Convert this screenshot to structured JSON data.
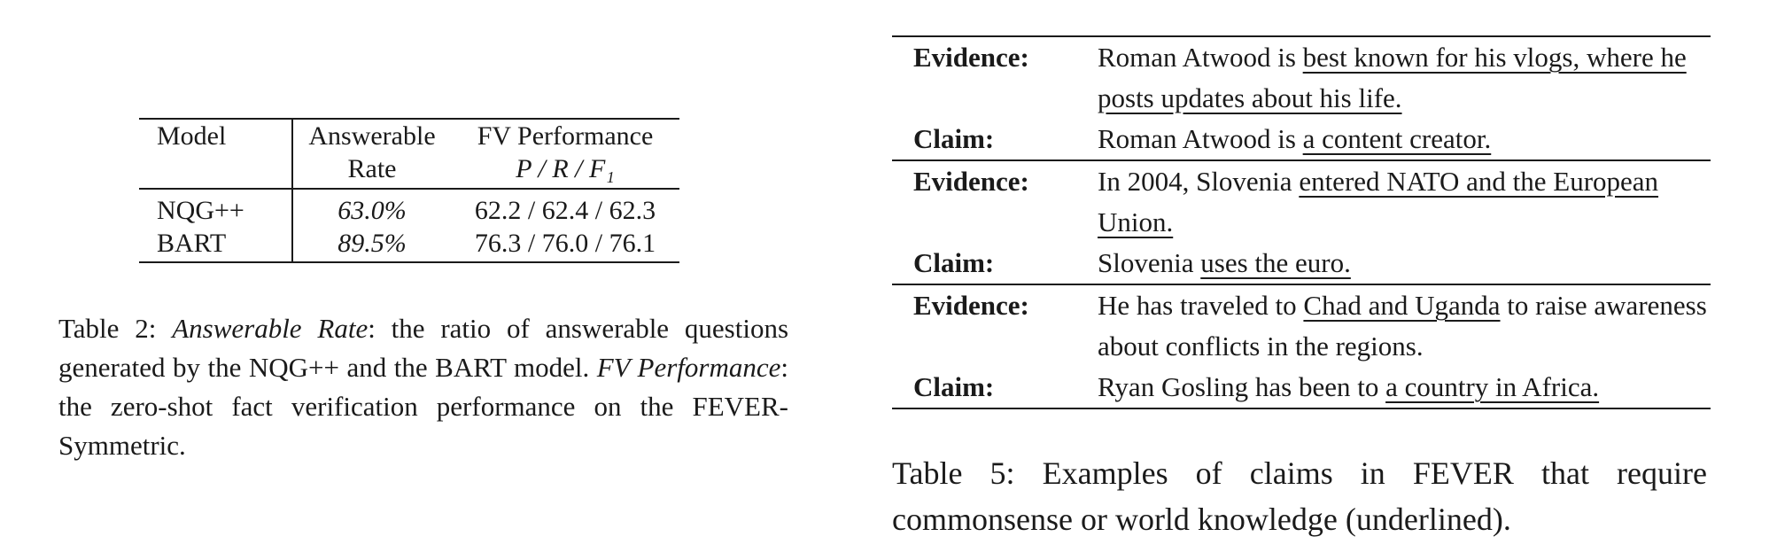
{
  "table2": {
    "headers": {
      "model": "Model",
      "rate_line1": "Answerable",
      "rate_line2": "Rate",
      "fv_line1": "FV Performance",
      "fv_line2": "P / R / F₁"
    },
    "rows": [
      {
        "model": "NQG++",
        "rate": "63.0%",
        "fv": "62.2 / 62.4 / 62.3"
      },
      {
        "model": "BART",
        "rate": "89.5%",
        "fv": "76.3 / 76.0 / 76.1"
      }
    ],
    "caption": {
      "prefix": "Table 2: ",
      "term1": "Answerable Rate",
      "text1": ": the ratio of answerable questions generated by the NQG++ and the BART model. ",
      "term2": "FV Performance",
      "text2": ": the zero-shot fact verification performance on the FEVER-Symmetric."
    }
  },
  "table5": {
    "evidence_label": "Evidence:",
    "claim_label": "Claim:",
    "examples": [
      {
        "evidence_pre": "Roman Atwood is ",
        "evidence_u": "best known for his vlogs, where he posts updates about his life.",
        "evidence_post": "",
        "claim_pre": "Roman Atwood is ",
        "claim_u": "a content creator."
      },
      {
        "evidence_pre": "In 2004, Slovenia ",
        "evidence_u": "entered NATO and the European Union.",
        "evidence_post": "",
        "claim_pre": "Slovenia ",
        "claim_u": "uses the euro."
      },
      {
        "evidence_pre": "He has traveled to ",
        "evidence_u": "Chad and Uganda",
        "evidence_post": " to raise awareness about conflicts in the regions.",
        "claim_pre": "Ryan Gosling has been to ",
        "claim_u": "a country in Africa."
      }
    ],
    "caption": "Table 5: Examples of claims in FEVER that require commonsense or world knowledge (underlined)."
  }
}
